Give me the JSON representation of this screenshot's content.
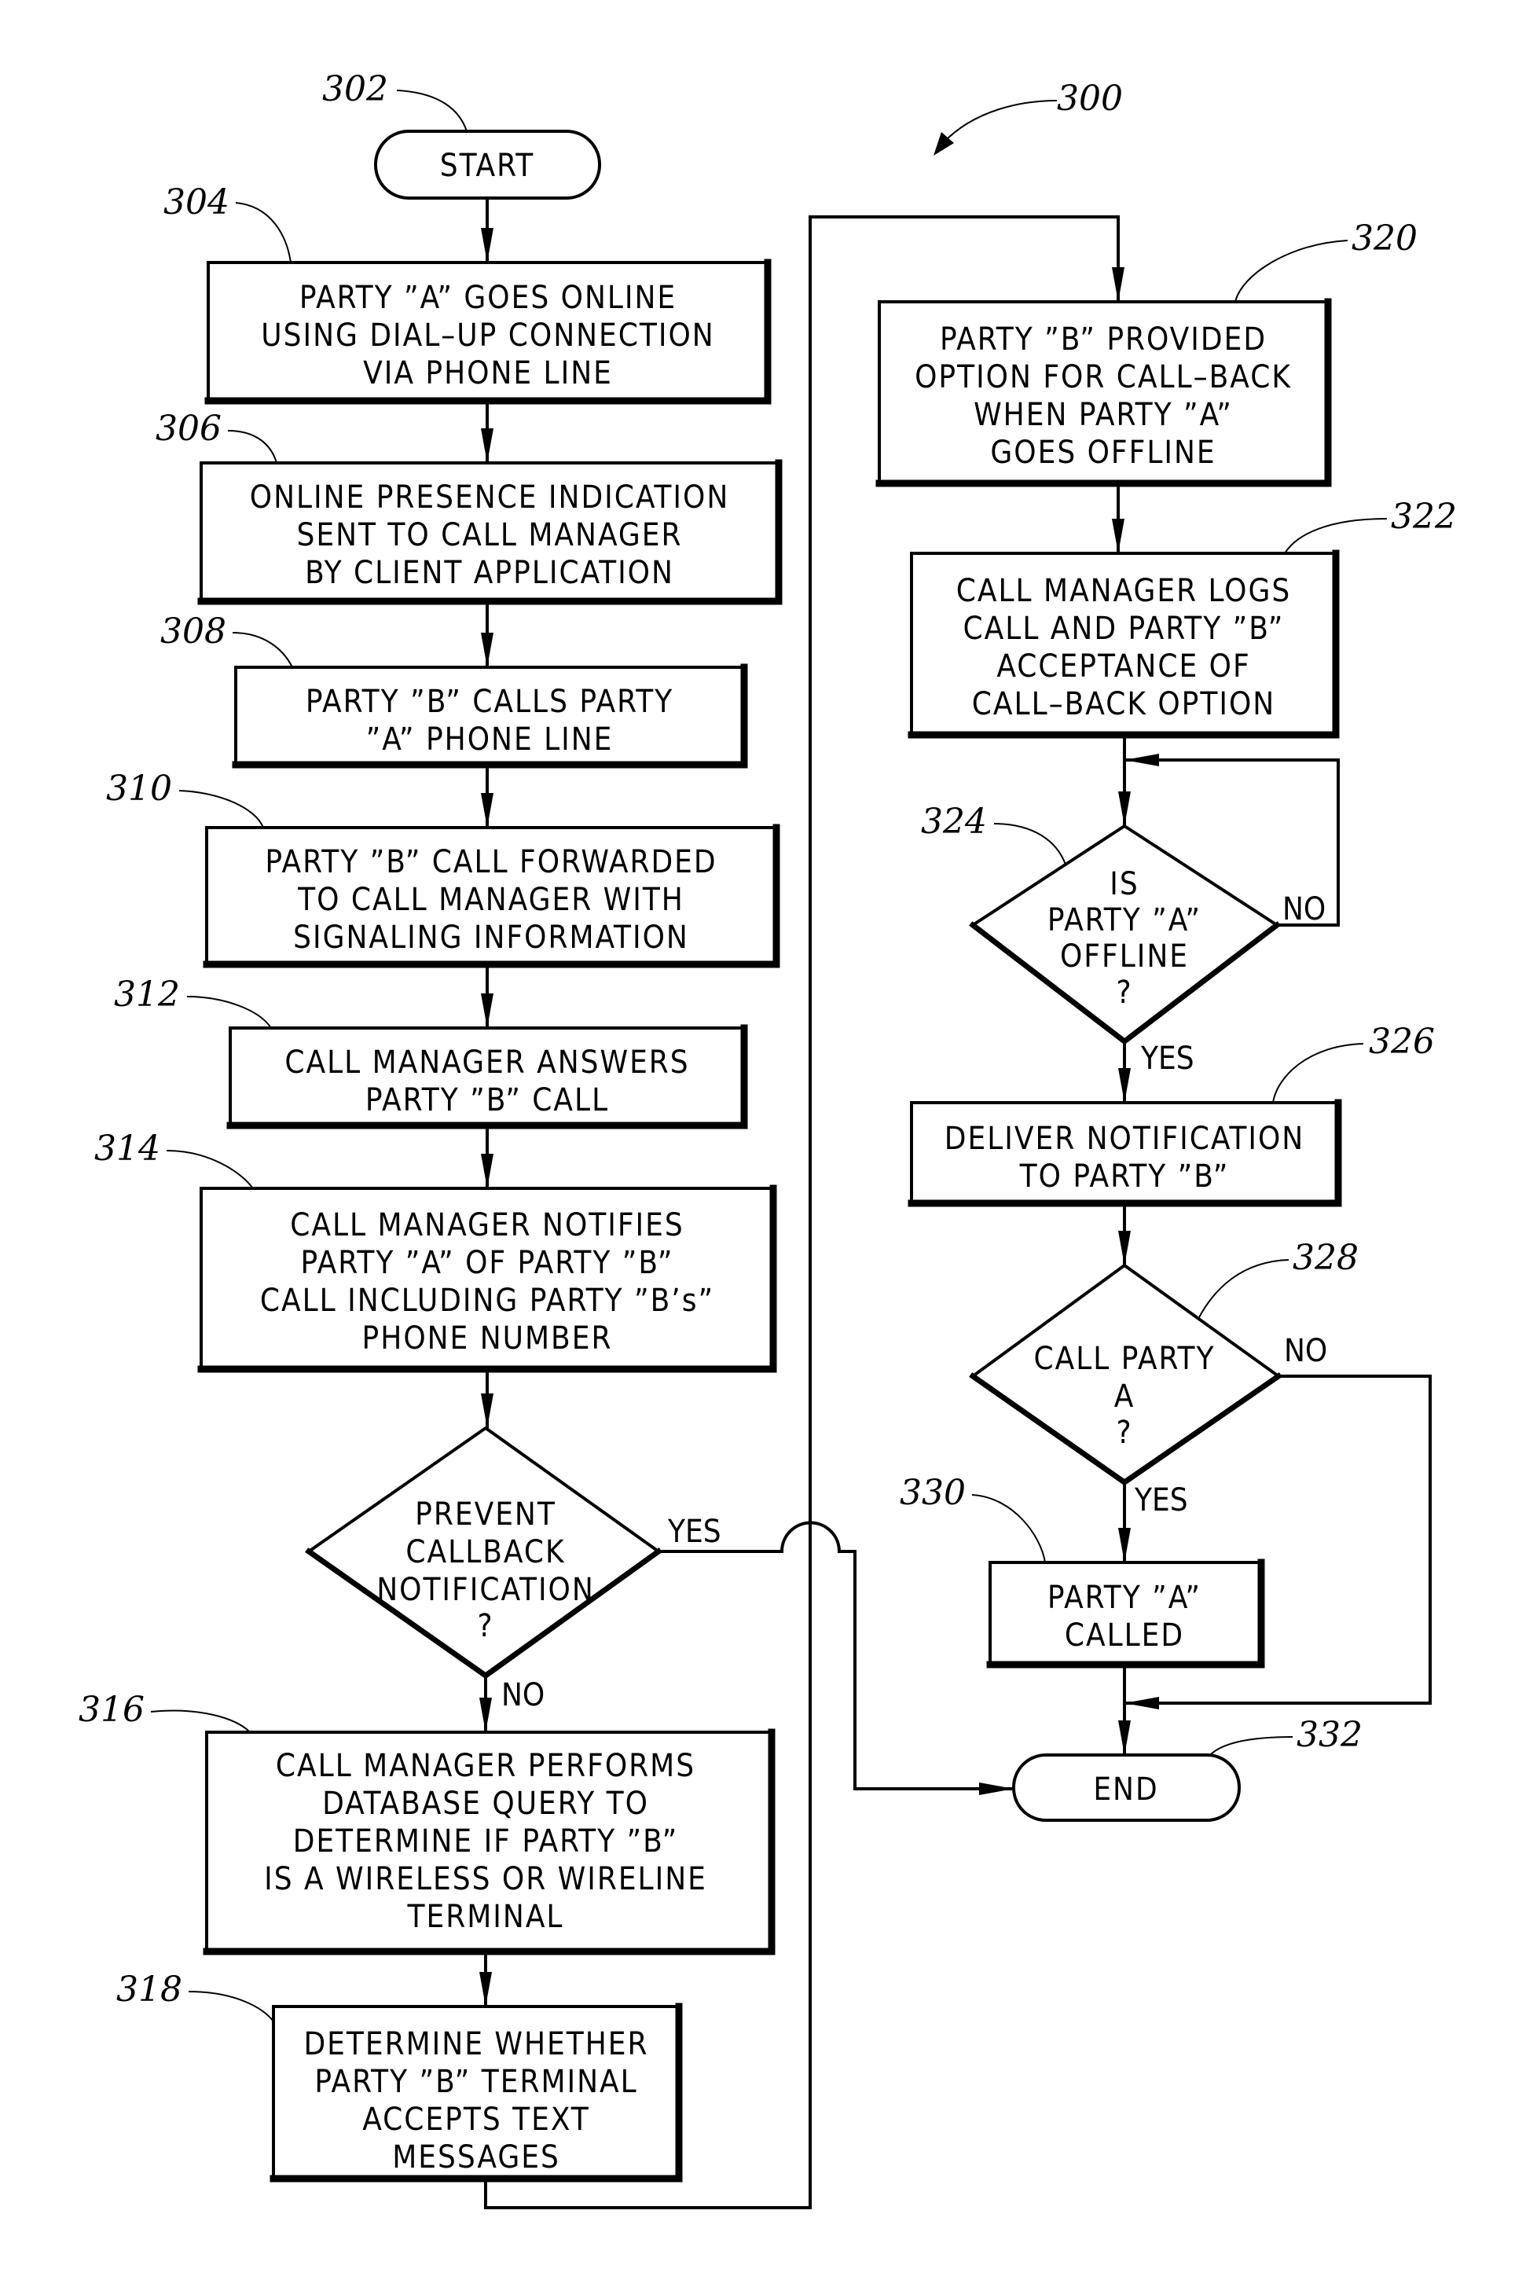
{
  "figure": {
    "ref": "300",
    "nodes": [
      {
        "id": "302",
        "type": "terminator",
        "lines": [
          "START"
        ]
      },
      {
        "id": "304",
        "type": "process",
        "lines": [
          "PARTY ”A” GOES ONLINE",
          "USING DIAL–UP CONNECTION",
          "VIA PHONE LINE"
        ]
      },
      {
        "id": "306",
        "type": "process",
        "lines": [
          "ONLINE PRESENCE INDICATION",
          "SENT TO CALL MANAGER",
          "BY CLIENT APPLICATION"
        ]
      },
      {
        "id": "308",
        "type": "process",
        "lines": [
          "PARTY ”B” CALLS PARTY",
          "”A” PHONE LINE"
        ]
      },
      {
        "id": "310",
        "type": "process",
        "lines": [
          "PARTY ”B” CALL FORWARDED",
          "TO CALL MANAGER WITH",
          "SIGNALING INFORMATION"
        ]
      },
      {
        "id": "312",
        "type": "process",
        "lines": [
          "CALL MANAGER ANSWERS",
          "PARTY ”B” CALL"
        ]
      },
      {
        "id": "314",
        "type": "process",
        "lines": [
          "CALL MANAGER NOTIFIES",
          "PARTY ”A” OF PARTY ”B”",
          "CALL INCLUDING PARTY ”B’s”",
          "PHONE NUMBER"
        ]
      },
      {
        "id": "prevent",
        "type": "decision",
        "lines": [
          "PREVENT",
          "CALLBACK",
          "NOTIFICATION",
          "?"
        ]
      },
      {
        "id": "316",
        "type": "process",
        "lines": [
          "CALL MANAGER PERFORMS",
          "DATABASE QUERY TO",
          "DETERMINE IF PARTY ”B”",
          "IS A WIRELESS OR WIRELINE",
          "TERMINAL"
        ]
      },
      {
        "id": "318",
        "type": "process",
        "lines": [
          "DETERMINE WHETHER",
          "PARTY ”B” TERMINAL",
          "ACCEPTS TEXT",
          "MESSAGES"
        ]
      },
      {
        "id": "320",
        "type": "process",
        "lines": [
          "PARTY ”B” PROVIDED",
          "OPTION FOR CALL–BACK",
          "WHEN PARTY ”A”",
          "GOES OFFLINE"
        ]
      },
      {
        "id": "322",
        "type": "process",
        "lines": [
          "CALL MANAGER LOGS",
          "CALL AND PARTY ”B”",
          "ACCEPTANCE OF",
          "CALL–BACK OPTION"
        ]
      },
      {
        "id": "324",
        "type": "decision",
        "lines": [
          "IS",
          "PARTY ”A”",
          "OFFLINE",
          "?"
        ]
      },
      {
        "id": "326",
        "type": "process",
        "lines": [
          "DELIVER NOTIFICATION",
          "TO PARTY ”B”"
        ]
      },
      {
        "id": "328",
        "type": "decision",
        "lines": [
          "CALL PARTY",
          "A",
          "?"
        ]
      },
      {
        "id": "330",
        "type": "process",
        "lines": [
          "PARTY ”A”",
          "CALLED"
        ]
      },
      {
        "id": "332",
        "type": "terminator",
        "lines": [
          "END"
        ]
      }
    ],
    "branch_labels": {
      "prevent_yes": "YES",
      "prevent_no": "NO",
      "d324_no": "NO",
      "d324_yes": "YES",
      "d328_no": "NO",
      "d328_yes": "YES"
    },
    "refs": {
      "r300": "300",
      "r302": "302",
      "r304": "304",
      "r306": "306",
      "r308": "308",
      "r310": "310",
      "r312": "312",
      "r314": "314",
      "r316": "316",
      "r318": "318",
      "r320": "320",
      "r322": "322",
      "r324": "324",
      "r326": "326",
      "r328": "328",
      "r330": "330",
      "r332": "332"
    }
  }
}
